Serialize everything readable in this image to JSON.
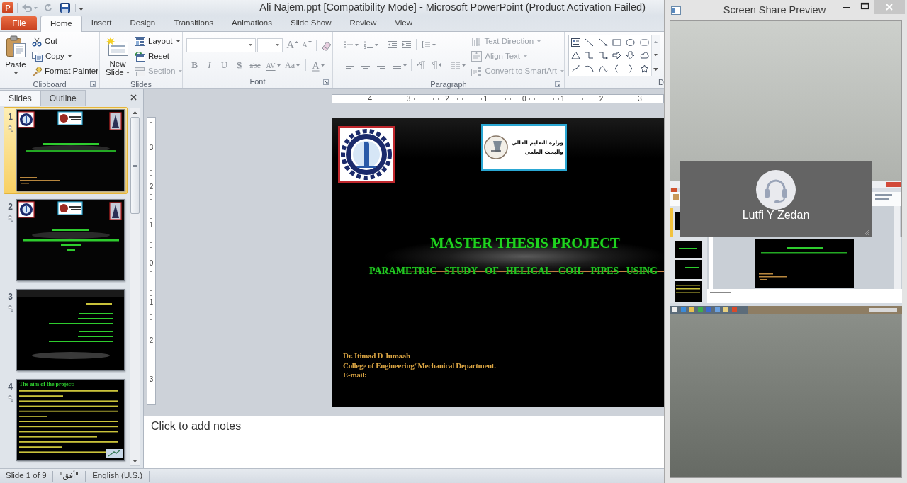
{
  "title_bar": {
    "app_icon": "P",
    "title": "Ali Najem.ppt [Compatibility Mode] - Microsoft PowerPoint (Product Activation Failed)"
  },
  "ribbon_tabs": [
    {
      "label": "File",
      "kind": "backstage",
      "selected": false
    },
    {
      "label": "Home",
      "kind": "tab",
      "selected": true
    },
    {
      "label": "Insert",
      "kind": "tab",
      "selected": false
    },
    {
      "label": "Design",
      "kind": "tab",
      "selected": false
    },
    {
      "label": "Transitions",
      "kind": "tab",
      "selected": false
    },
    {
      "label": "Animations",
      "kind": "tab",
      "selected": false
    },
    {
      "label": "Slide Show",
      "kind": "tab",
      "selected": false
    },
    {
      "label": "Review",
      "kind": "tab",
      "selected": false
    },
    {
      "label": "View",
      "kind": "tab",
      "selected": false
    }
  ],
  "clipboard": {
    "label": "Clipboard",
    "paste": "Paste",
    "commands": [
      {
        "kind": "cut",
        "label": "Cut",
        "dropdown": false
      },
      {
        "kind": "copy",
        "label": "Copy",
        "dropdown": true
      },
      {
        "kind": "format_painter",
        "label": "Format Painter",
        "dropdown": false
      }
    ]
  },
  "slides_group": {
    "label": "Slides",
    "new_slide": "New Slide",
    "commands": [
      {
        "kind": "layout",
        "label": "Layout",
        "dropdown": true,
        "disabled": false
      },
      {
        "kind": "reset",
        "label": "Reset",
        "dropdown": false,
        "disabled": false
      },
      {
        "kind": "section",
        "label": "Section",
        "dropdown": true,
        "disabled": true
      }
    ]
  },
  "font": {
    "label": "Font",
    "disabled": true,
    "size_buttons": [
      {
        "kind": "grow",
        "label": "A"
      },
      {
        "kind": "shrink",
        "label": "A"
      }
    ],
    "style_buttons": [
      {
        "kind": "bold",
        "label": "B",
        "dropdown": false
      },
      {
        "kind": "italic",
        "label": "I",
        "dropdown": false
      },
      {
        "kind": "underline",
        "label": "U",
        "dropdown": false
      },
      {
        "kind": "shadow",
        "label": "S",
        "dropdown": false
      },
      {
        "kind": "strike",
        "label": "abc",
        "dropdown": false
      },
      {
        "kind": "spacing",
        "label": "AV",
        "dropdown": true
      },
      {
        "kind": "case",
        "label": "Aa",
        "dropdown": true
      },
      {
        "kind": "color",
        "label": "A",
        "dropdown": true
      }
    ]
  },
  "paragraph": {
    "label": "Paragraph",
    "disabled": true,
    "commands": [
      {
        "kind": "text_direction",
        "label": "Text Direction",
        "dropdown": true,
        "disabled": true
      },
      {
        "kind": "align_text",
        "label": "Align Text",
        "dropdown": true,
        "disabled": true
      },
      {
        "kind": "smartart",
        "label": "Convert to SmartArt",
        "dropdown": true,
        "disabled": true
      }
    ]
  },
  "drawing": {
    "label": "D"
  },
  "slides_panel": {
    "tabs": [
      {
        "label": "Slides",
        "selected": true
      },
      {
        "label": "Outline",
        "selected": false
      }
    ],
    "slides": [
      {
        "number": "1",
        "selected": true,
        "animated": true,
        "kind": "title_slide"
      },
      {
        "number": "2",
        "selected": false,
        "animated": true,
        "kind": "arabic_title"
      },
      {
        "number": "3",
        "selected": false,
        "animated": true,
        "kind": "arabic_list"
      },
      {
        "number": "4",
        "selected": false,
        "animated": true,
        "kind": "bullets",
        "title": "The aim of the project:"
      }
    ]
  },
  "rulers": {
    "horizontal": [
      "4",
      "3",
      "2",
      "1",
      "0",
      "1",
      "2",
      "3"
    ],
    "vertical": [
      "3",
      "2",
      "1",
      "0",
      "1",
      "2",
      "3"
    ]
  },
  "slide": {
    "ministry_logo": [
      "وزارة التعليم العالي",
      "والبحث العلمي"
    ],
    "title": "MASTER THESIS PROJECT",
    "subtitle": "PARAMETRIC STUDY OF HELICAL COIL PIPES USING",
    "author_lines": [
      "Dr. Itimad D Jumaah",
      "College of Engineering/ Mechanical Department.",
      "E-mail:"
    ]
  },
  "notes": {
    "placeholder": "Click to add notes"
  },
  "status_bar": {
    "slide_counter": "Slide 1 of 9",
    "theme": "\"أفق\"",
    "language": "English (U.S.)"
  },
  "share_window": {
    "title": "Screen Share Preview",
    "presenter": "Lutfi Y Zedan"
  }
}
